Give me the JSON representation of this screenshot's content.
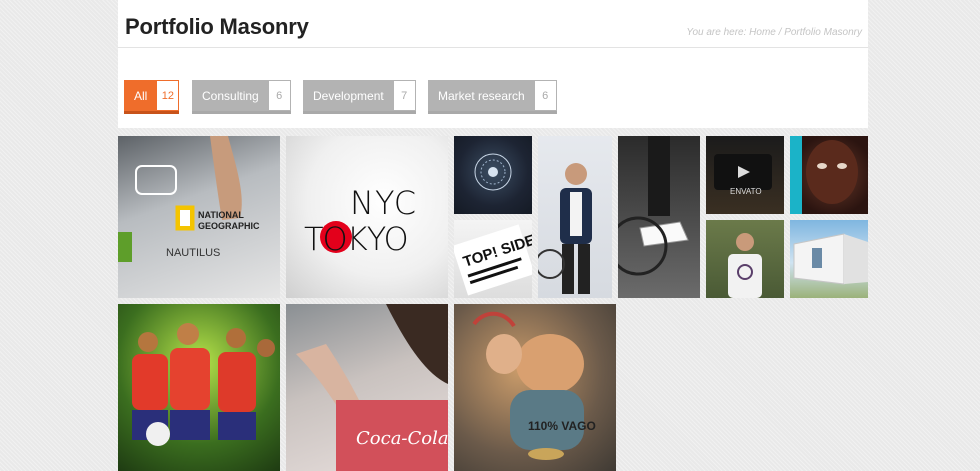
{
  "header": {
    "title": "Portfolio Masonry",
    "breadcrumb": {
      "prefix": "You are here:",
      "home": "Home",
      "separator": "/",
      "current": "Portfolio Masonry"
    }
  },
  "filters": [
    {
      "label": "All",
      "count": "12",
      "active": true
    },
    {
      "label": "Consulting",
      "count": "6",
      "active": false
    },
    {
      "label": "Development",
      "count": "7",
      "active": false
    },
    {
      "label": "Market research",
      "count": "6",
      "active": false
    }
  ],
  "portfolio": {
    "tile_texts": {
      "ng_line1": "NATIONAL",
      "ng_line2": "GEOGRAPHIC",
      "ng_line3": "NAUTILUS",
      "nyc": "NYC",
      "tokyo": "TOKYO",
      "envato": "ENVATO",
      "topside": "TOP! SIDE!",
      "cola": "Coca-Cola",
      "vago": "110% VAGO"
    }
  },
  "colors": {
    "accent": "#ef6d2b",
    "filter_inactive": "#b3b3b3",
    "background": "#e9e9e9"
  }
}
